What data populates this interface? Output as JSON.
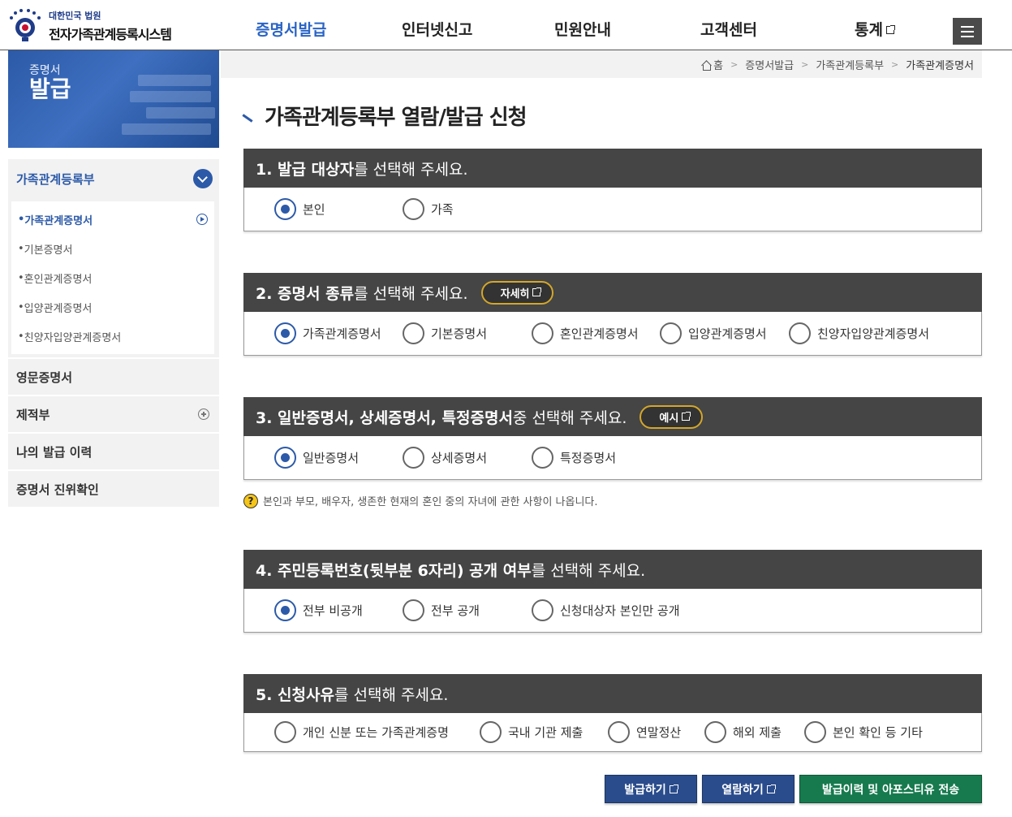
{
  "header": {
    "org": "대한민국 법원",
    "system_name": "전자가족관계등록시스템",
    "nav": [
      {
        "label": "증명서발급",
        "active": true
      },
      {
        "label": "인터넷신고"
      },
      {
        "label": "민원안내"
      },
      {
        "label": "고객센터"
      },
      {
        "label": "통계"
      }
    ]
  },
  "banner": {
    "line1": "증명서",
    "line2": "발급"
  },
  "sidebar": {
    "group_title": "가족관계등록부",
    "sub_items": [
      "가족관계증명서",
      "기본증명서",
      "혼인관계증명서",
      "입양관계증명서",
      "친양자입양관계증명서"
    ],
    "items": [
      "영문증명서",
      "제적부",
      "나의 발급 이력",
      "증명서 진위확인"
    ]
  },
  "breadcrumb": [
    "홈",
    "증명서발급",
    "가족관계등록부",
    "가족관계증명서"
  ],
  "page_title": "가족관계등록부 열람/발급 신청",
  "sections": [
    {
      "bold": "1. 발급 대상자",
      "rest": "를 선택해 주세요.",
      "options": [
        "본인",
        "가족"
      ],
      "selected": 0
    },
    {
      "bold": "2. 증명서 종류",
      "rest": "를 선택해 주세요.",
      "button": "자세히",
      "options": [
        "가족관계증명서",
        "기본증명서",
        "혼인관계증명서",
        "입양관계증명서",
        "친양자입양관계증명서"
      ],
      "selected": 0
    },
    {
      "bold": "3. 일반증명서, 상세증명서, 특정증명서",
      "rest": " 중 선택해 주세요.",
      "button": "예시",
      "options": [
        "일반증명서",
        "상세증명서",
        "특정증명서"
      ],
      "selected": 0
    },
    {
      "bold": "4. 주민등록번호(뒷부분 6자리) 공개 여부",
      "rest": "를 선택해 주세요.",
      "options": [
        "전부 비공개",
        "전부 공개",
        "신청대상자 본인만 공개"
      ],
      "selected": 0
    },
    {
      "bold": "5. 신청사유",
      "rest": "를 선택해 주세요.",
      "options": [
        "개인 신분 또는 가족관계증명",
        "국내 기관 제출",
        "연말정산",
        "해외 제출",
        "본인 확인 등 기타"
      ],
      "selected": null
    }
  ],
  "note": "본인과 부모, 배우자, 생존한 현재의 혼인 중의 자녀에 관한 사항이 나옵니다.",
  "actions": {
    "issue": "발급하기",
    "view": "열람하기",
    "history": "발급이력 및 아포스티유 전송"
  },
  "colors": {
    "primary": "#2c5aa8",
    "section_header": "#454545",
    "green": "#177a4e"
  }
}
